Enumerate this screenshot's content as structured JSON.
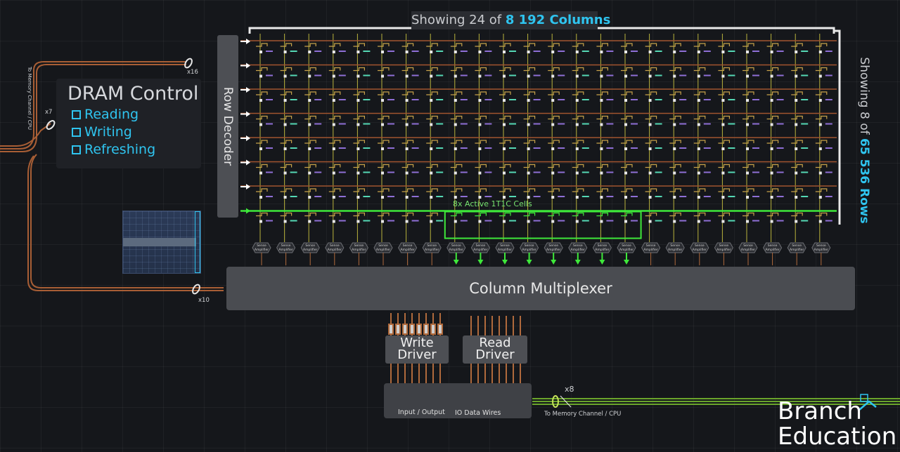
{
  "header": {
    "columns_prefix": "Showing 24 of ",
    "columns_highlight": "8 192 Columns",
    "rows_prefix": "Showing 8 of ",
    "rows_highlight": "65 536 Rows"
  },
  "row_decoder": {
    "label": "Row Decoder"
  },
  "dram_control": {
    "title": "DRAM Control",
    "items": [
      "Reading",
      "Writing",
      "Refreshing"
    ]
  },
  "array": {
    "columns_shown": 24,
    "rows_shown": 8,
    "active_row_index": 7,
    "active_columns_start": 8,
    "active_columns_count": 8,
    "active_label": "8x Active 1T1C Cells",
    "sense_amp_label": "Sense Amplifier"
  },
  "column_multiplexer": {
    "label": "Column Multiplexer"
  },
  "write_driver": {
    "line1": "Write",
    "line2": "Driver"
  },
  "read_driver": {
    "line1": "Read",
    "line2": "Driver"
  },
  "io": {
    "input_output": "Input / Output",
    "data_wires": "IO Data Wires"
  },
  "bus": {
    "top_count": "x16",
    "mid_count": "x7",
    "bottom_count": "x10",
    "right_count": "x8",
    "left_label": "To Memory Channel / CPU",
    "right_label": "To Memory Channel / CPU"
  },
  "brand": {
    "line1": "Branch",
    "line2": "Education"
  },
  "colors": {
    "accent_cyan": "#2fc4ef",
    "active_green": "#3ee83a",
    "wire_copper": "#b0643a",
    "wordline_amber": "#c8a24a",
    "bitline_yellow": "#b9b33d"
  }
}
